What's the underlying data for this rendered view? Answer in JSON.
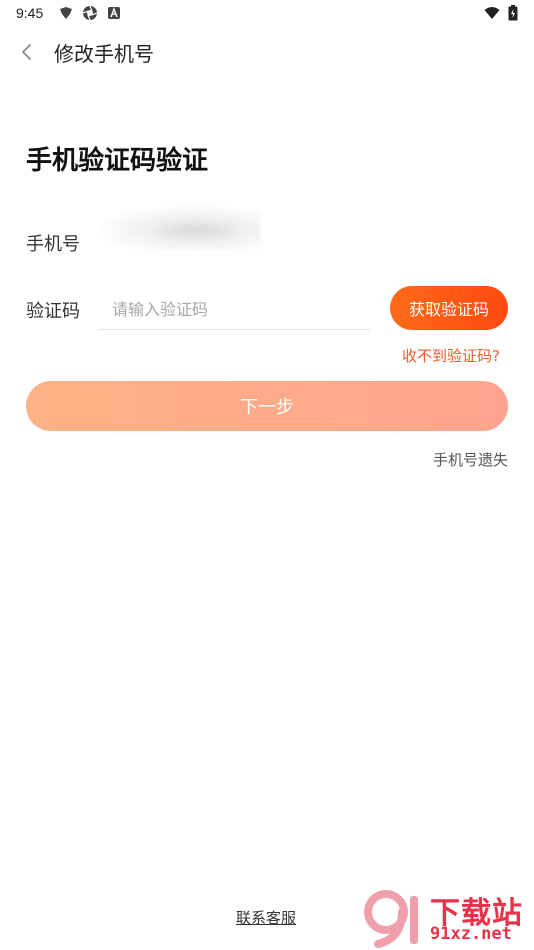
{
  "status_bar": {
    "time": "9:45",
    "left_icons": [
      "bird-notification-icon",
      "aperture-notification-icon",
      "a-notification-icon"
    ],
    "right_icons": [
      "wifi-icon",
      "battery-icon"
    ]
  },
  "header": {
    "back_icon": "chevron-left-icon",
    "title": "修改手机号"
  },
  "main": {
    "title": "手机验证码验证",
    "phone_label": "手机号",
    "phone_value": "",
    "code_label": "验证码",
    "code_placeholder": "请输入验证码",
    "code_value": "",
    "get_code_button": "获取验证码",
    "no_code_link": "收不到验证码?",
    "next_button": "下一步",
    "lost_phone_link": "手机号遗失"
  },
  "footer": {
    "contact_link": "联系客服"
  },
  "watermark": {
    "text_top": "下载站",
    "text_bottom": "91xz.net"
  },
  "colors": {
    "accent_orange": "#ff5a16",
    "link_red": "#f25a2a",
    "next_button_start": "#ffb285",
    "next_button_end": "#ffa38e",
    "watermark_red": "#e8324a"
  }
}
